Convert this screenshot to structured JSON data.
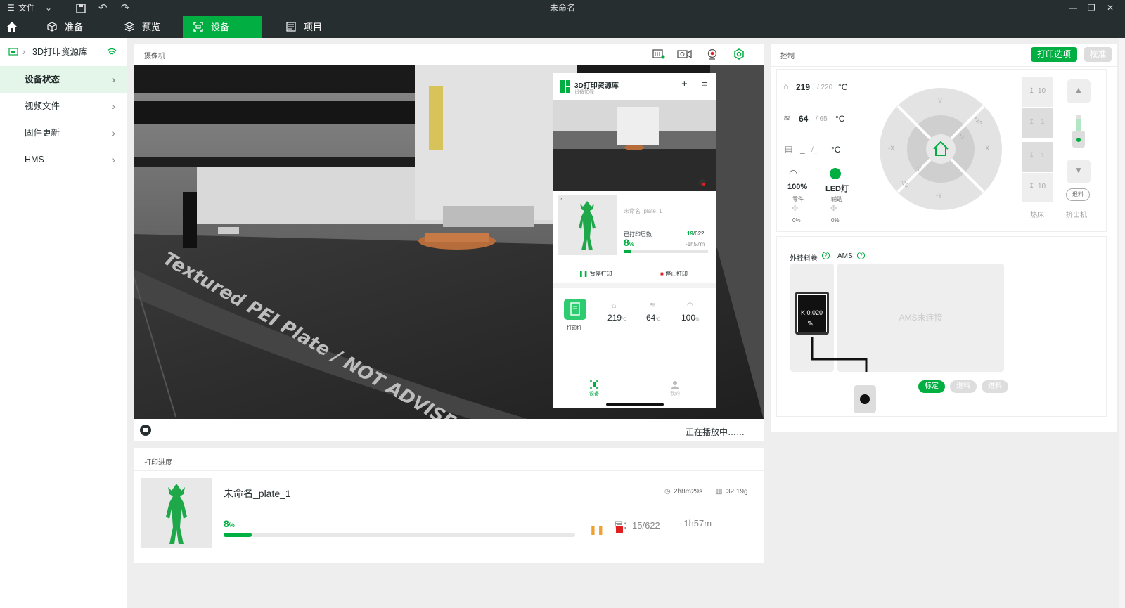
{
  "titlebar": {
    "menu_label": "文件",
    "window_title": "未命名"
  },
  "tabs": [
    {
      "label": "准备"
    },
    {
      "label": "预览"
    },
    {
      "label": "设备"
    },
    {
      "label": "项目"
    }
  ],
  "sidebar": {
    "printer_name": "3D打印资源库",
    "items": [
      {
        "label": "设备状态"
      },
      {
        "label": "视频文件"
      },
      {
        "label": "固件更新"
      },
      {
        "label": "HMS"
      }
    ]
  },
  "camera": {
    "title": "摄像机",
    "status": "正在播放中……",
    "overlay": {
      "app_title": "3D打印资源库",
      "app_subtitle": "设备忙碌",
      "plate_index": "1",
      "plate_name": "未命名_plate_1",
      "layers_label": "已打印层数",
      "layers_done": "19",
      "layers_total": "/622",
      "percent": "8",
      "percent_unit": "%",
      "remaining": "-1h57m",
      "pause_label": "暂停打印",
      "stop_label": "停止打印",
      "printer_label": "打印机",
      "nozzle_temp": "219",
      "bed_temp": "64",
      "fan_speed": "100",
      "temp_unit": "°C",
      "fan_unit": "%",
      "nav_device": "设备",
      "nav_me": "我的"
    }
  },
  "progress": {
    "title": "打印进度",
    "file_name": "未命名_plate_1",
    "percent": "8",
    "percent_unit": "%",
    "percent_value": 0.08,
    "layer_label": "层：",
    "layers": "15/622",
    "remaining": "-1h57m",
    "total_time": "2h8m29s",
    "weight": "32.19g"
  },
  "control": {
    "title": "控制",
    "print_options_label": "打印选项",
    "calibrate_label": "校准",
    "nozzle_temp": "219",
    "nozzle_target": "/ 220",
    "bed_temp": "64",
    "bed_target": "/ 65",
    "chamber_temp": "_",
    "chamber_target": "/_",
    "temp_unit": "°C",
    "speed": "100%",
    "led_label": "LED灯",
    "part_fan_label": "零件",
    "aux_fan_label": "辅助",
    "part_fan_value": "0%",
    "aux_fan_value": "0%",
    "jog": {
      "y": "Y",
      "neg_y": "-Y",
      "x": "X",
      "neg_x": "-X",
      "p10": "+10",
      "p1": "+1",
      "n1": "-1",
      "n10": "-10"
    },
    "bed_up10": "10",
    "bed_up1": "1",
    "bed_down1": "1",
    "bed_down10": "10",
    "bed_label": "热床",
    "extruder_label": "挤出机",
    "retract_label": "退料"
  },
  "filament": {
    "external_spool_label": "外挂料卷",
    "ams_label": "AMS",
    "k_value": "K 0.020",
    "ams_status": "AMS未连接",
    "calibrate_label": "标定",
    "unload_label": "退料",
    "load_label": "进料"
  },
  "colors": {
    "accent": "#00ae42",
    "titlebar": "#262e30",
    "stop": "#e02020",
    "pause": "#f0a030"
  }
}
